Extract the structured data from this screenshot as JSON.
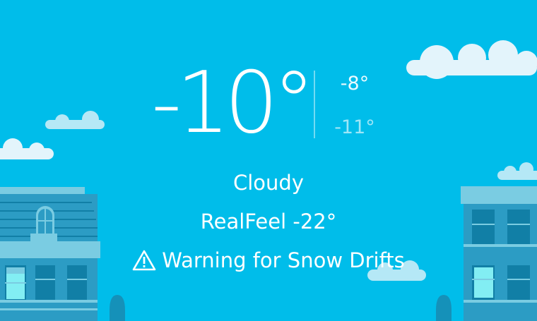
{
  "colors": {
    "sky": "#00BDEA",
    "cloud": "#B5E8F6",
    "cloud_bright": "#E3F4FB",
    "building_main": "#2C9CC4",
    "building_light": "#7ACCE2",
    "window_dark": "#117FA6",
    "window_lit": "#82EEF3",
    "text": "#FFFFFF"
  },
  "weather": {
    "current_temp": "-10°",
    "high_temp": "-8°",
    "low_temp": "-11°",
    "condition": "Cloudy",
    "realfeel": "RealFeel -22°",
    "alert": {
      "icon": "warning-triangle-icon",
      "text": "Warning for Snow Drifts"
    }
  }
}
